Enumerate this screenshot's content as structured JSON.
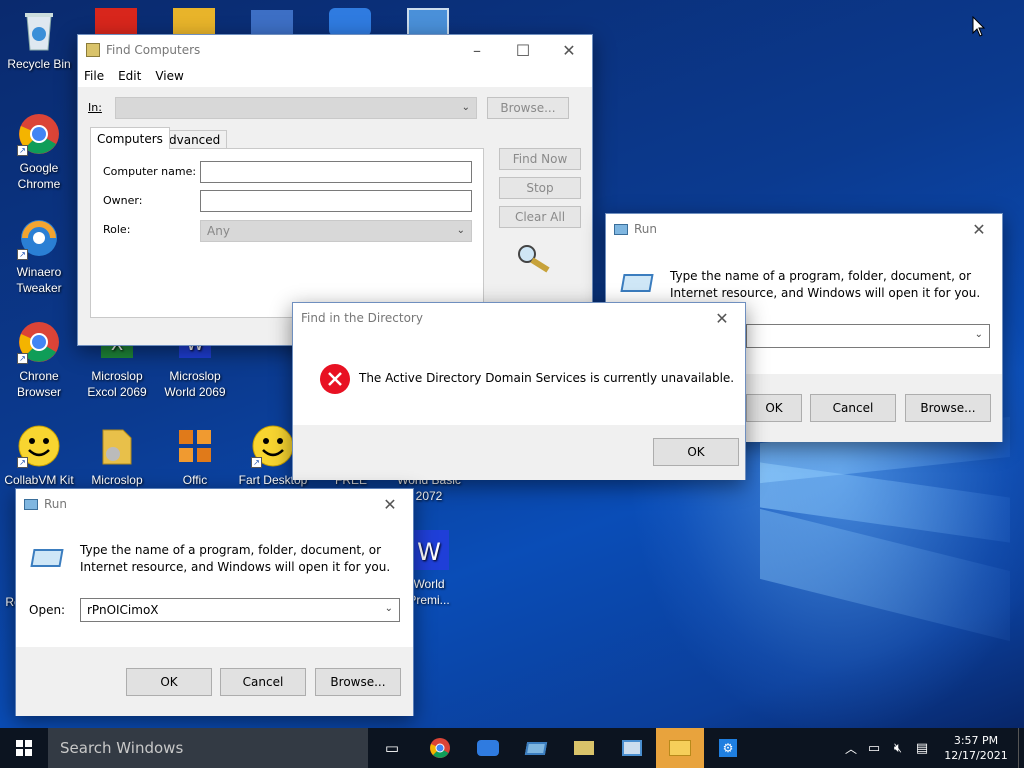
{
  "desktop": {
    "icons": [
      {
        "label": "Recycle Bin",
        "icon": "recycle-bin-icon"
      },
      {
        "label": "Google\nChrome",
        "icon": "chrome-icon"
      },
      {
        "label": "Winaero\nTweaker",
        "icon": "winaero-tweaker-icon"
      },
      {
        "label": "Chrone\nBrowser",
        "icon": "chrome-icon"
      },
      {
        "label": "Microslop\nExcol 2069",
        "icon": "excel-icon"
      },
      {
        "label": "Microslop\nWorld 2069",
        "icon": "word-icon"
      },
      {
        "label": "CollabVM Kit",
        "icon": "smiley-icon"
      },
      {
        "label": "Microslop",
        "icon": "folder-icon"
      },
      {
        "label": "Offic",
        "icon": "office-icon"
      },
      {
        "label": "Fart Desktop",
        "icon": "smiley-icon"
      },
      {
        "label": "FREE",
        "icon": "generic-icon"
      },
      {
        "label": "World Basic\n2072",
        "icon": "generic-icon"
      },
      {
        "label": "World\nPremi...",
        "icon": "word-icon"
      },
      {
        "label": "Re",
        "icon": "generic-icon"
      }
    ]
  },
  "find_computers": {
    "title": "Find Computers",
    "menu": [
      "File",
      "Edit",
      "View"
    ],
    "in_label": "In:",
    "browse": "Browse...",
    "tabs": [
      "Computers",
      "Advanced"
    ],
    "computer_name_label": "Computer name:",
    "owner_label": "Owner:",
    "role_label": "Role:",
    "role_value": "Any",
    "find_now": "Find Now",
    "stop": "Stop",
    "clear_all": "Clear All"
  },
  "error_dialog": {
    "title": "Find in the Directory",
    "message": "The Active Directory Domain Services is currently unavailable.",
    "ok": "OK"
  },
  "run_right": {
    "title": "Run",
    "description": "Type the name of a program, folder, document, or\nInternet resource, and Windows will open it for you.",
    "ok": "OK",
    "cancel": "Cancel",
    "browse": "Browse..."
  },
  "run_left": {
    "title": "Run",
    "description": "Type the name of a program, folder, document, or\nInternet resource, and Windows will open it for you.",
    "open_label": "Open:",
    "open_value": "rPnOICimoX",
    "ok": "OK",
    "cancel": "Cancel",
    "browse": "Browse..."
  },
  "taskbar": {
    "search_placeholder": "Search Windows",
    "time": "3:57 PM",
    "date": "12/17/2021"
  }
}
